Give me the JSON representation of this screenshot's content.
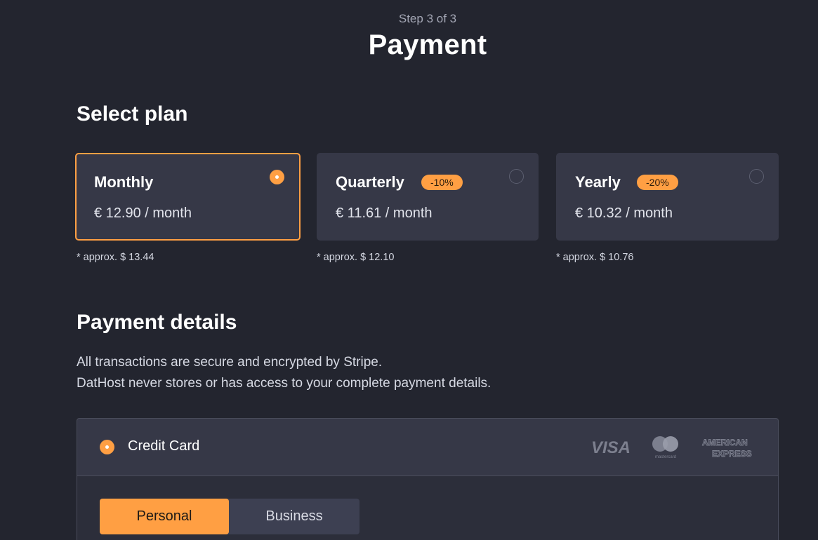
{
  "header": {
    "step": "Step 3 of 3",
    "title": "Payment"
  },
  "select_plan": {
    "title": "Select plan",
    "plans": [
      {
        "name": "Monthly",
        "badge": "",
        "price": "€ 12.90 / month",
        "note": "* approx. $ 13.44",
        "selected": true
      },
      {
        "name": "Quarterly",
        "badge": "-10%",
        "price": "€ 11.61 / month",
        "note": "* approx. $ 12.10",
        "selected": false
      },
      {
        "name": "Yearly",
        "badge": "-20%",
        "price": "€ 10.32 / month",
        "note": "* approx. $ 10.76",
        "selected": false
      }
    ]
  },
  "payment_details": {
    "title": "Payment details",
    "line1": "All transactions are secure and encrypted by Stripe.",
    "line2": "DatHost never stores or has access to your complete payment details.",
    "method": {
      "label": "Credit Card",
      "selected": true,
      "logos": [
        {
          "icon": "visa-logo-icon",
          "text": "VISA"
        },
        {
          "icon": "mastercard-logo-icon",
          "text": "mastercard"
        },
        {
          "icon": "amex-logo-icon",
          "text": "AMERICAN EXPRESS"
        }
      ]
    },
    "account_type": {
      "options": [
        "Personal",
        "Business"
      ],
      "selected": "Personal"
    }
  },
  "colors": {
    "background": "#23252f",
    "card": "#363847",
    "accent": "#ff9f43"
  }
}
